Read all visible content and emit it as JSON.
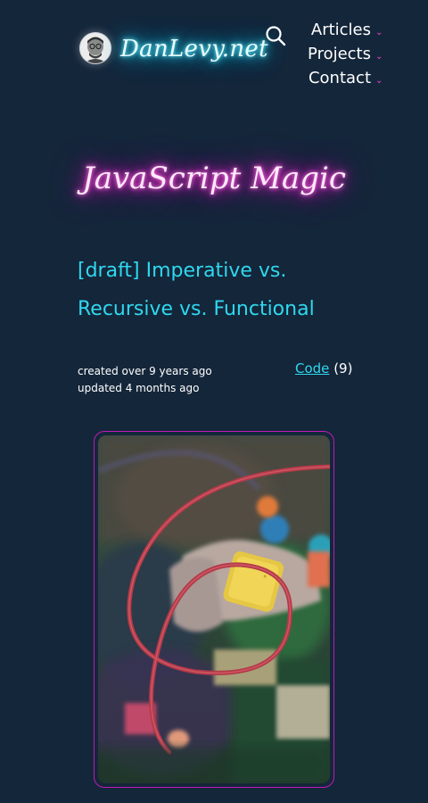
{
  "header": {
    "brand": "DanLevy.net",
    "search_icon": "search-icon",
    "nav": [
      {
        "label": "Articles",
        "icon": "chevron-down-icon"
      },
      {
        "label": "Projects",
        "icon": "chevron-down-icon"
      },
      {
        "label": "Contact",
        "icon": "chevron-down-icon"
      }
    ]
  },
  "section": {
    "title": "JavaScript Magic"
  },
  "post": {
    "title": "[draft] Imperative vs. Recursive vs. Functional",
    "created": "created over 9 years ago",
    "updated": "updated 4 months ago",
    "tag": {
      "label": "Code",
      "count": "(9)"
    }
  },
  "colors": {
    "background": "#14263a",
    "neon_cyan": "#2fe0ff",
    "neon_pink": "#ff31d8",
    "link": "#2fd8ee",
    "image_border": "#c11ab8"
  }
}
